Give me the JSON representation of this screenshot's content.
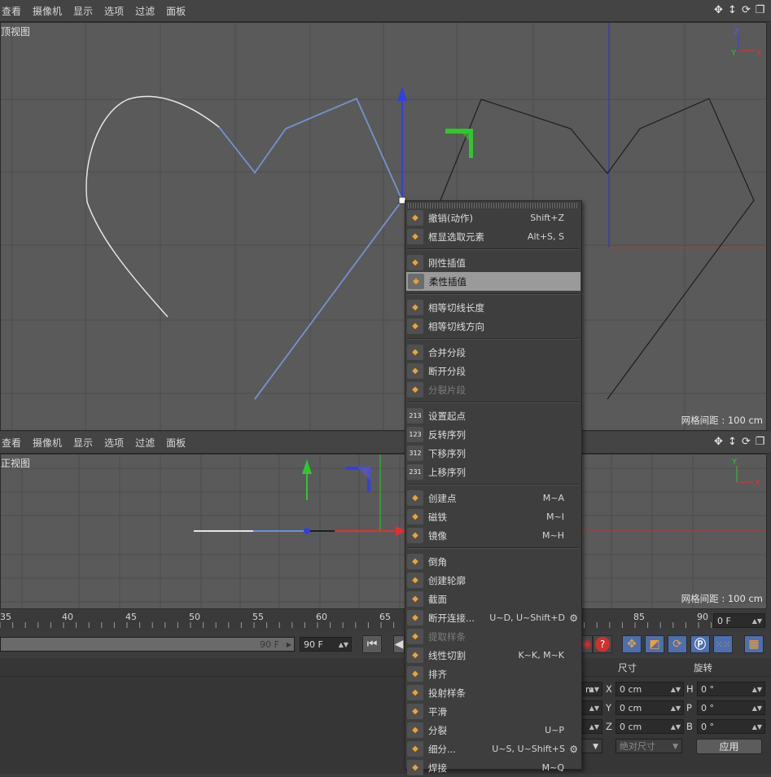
{
  "top_view": {
    "menu": [
      "查看",
      "摄像机",
      "显示",
      "选项",
      "过滤",
      "面板"
    ],
    "label": "顶视图",
    "grid_spacing": "网格间距 : 100 cm",
    "axis": {
      "z": "Z",
      "y": "Y",
      "x": "X"
    }
  },
  "front_view": {
    "menu": [
      "查看",
      "摄像机",
      "显示",
      "选项",
      "过滤",
      "面板"
    ],
    "label": "正视图",
    "grid_spacing": "网格间距 : 100 cm",
    "axis": {
      "y": "Y",
      "x": "X"
    }
  },
  "nav_icons": [
    "move-view-icon",
    "zoom-view-icon",
    "rotate-view-icon",
    "toggle-view-icon"
  ],
  "context_menu": {
    "groups": [
      [
        {
          "label": "撤销(动作)",
          "shortcut": "Shift+Z",
          "icon": "undo-icon"
        },
        {
          "label": "框显选取元素",
          "shortcut": "Alt+S, S",
          "icon": "frame-selected-icon"
        }
      ],
      [
        {
          "label": "刚性插值",
          "shortcut": "",
          "icon": "hard-interpolation-icon"
        },
        {
          "label": "柔性插值",
          "shortcut": "",
          "icon": "soft-interpolation-icon",
          "highlighted": true
        }
      ],
      [
        {
          "label": "相等切线长度",
          "shortcut": "",
          "icon": "equal-tangent-length-icon"
        },
        {
          "label": "相等切线方向",
          "shortcut": "",
          "icon": "equal-tangent-direction-icon"
        }
      ],
      [
        {
          "label": "合并分段",
          "shortcut": "",
          "icon": "join-segment-icon"
        },
        {
          "label": "断开分段",
          "shortcut": "",
          "icon": "break-segment-icon"
        },
        {
          "label": "分裂片段",
          "shortcut": "",
          "icon": "explode-segments-icon",
          "disabled": true
        }
      ],
      [
        {
          "label": "设置起点",
          "shortcut": "",
          "icon": "set-first-point-icon",
          "glyph": "213"
        },
        {
          "label": "反转序列",
          "shortcut": "",
          "icon": "reverse-sequence-icon",
          "glyph": "123"
        },
        {
          "label": "下移序列",
          "shortcut": "",
          "icon": "move-down-sequence-icon",
          "glyph": "312"
        },
        {
          "label": "上移序列",
          "shortcut": "",
          "icon": "move-up-sequence-icon",
          "glyph": "231"
        }
      ],
      [
        {
          "label": "创建点",
          "shortcut": "M~A",
          "icon": "create-point-icon"
        },
        {
          "label": "磁铁",
          "shortcut": "M~I",
          "icon": "magnet-icon"
        },
        {
          "label": "镜像",
          "shortcut": "M~H",
          "icon": "mirror-icon"
        }
      ],
      [
        {
          "label": "倒角",
          "shortcut": "",
          "icon": "chamfer-icon"
        },
        {
          "label": "创建轮廓",
          "shortcut": "",
          "icon": "create-outline-icon"
        },
        {
          "label": "截面",
          "shortcut": "",
          "icon": "cross-section-icon"
        },
        {
          "label": "断开连接...",
          "shortcut": "U~D, U~Shift+D",
          "icon": "disconnect-icon",
          "gear": true
        },
        {
          "label": "提取样条",
          "shortcut": "",
          "icon": "edge-to-spline-icon",
          "disabled": true
        },
        {
          "label": "线性切割",
          "shortcut": "K~K, M~K",
          "icon": "line-cut-icon"
        },
        {
          "label": "排齐",
          "shortcut": "",
          "icon": "line-up-icon"
        },
        {
          "label": "投射样条",
          "shortcut": "",
          "icon": "project-spline-icon"
        },
        {
          "label": "平滑",
          "shortcut": "",
          "icon": "smooth-icon"
        },
        {
          "label": "分裂",
          "shortcut": "U~P",
          "icon": "split-icon"
        },
        {
          "label": "细分...",
          "shortcut": "U~S, U~Shift+S",
          "icon": "subdivide-icon",
          "gear": true
        },
        {
          "label": "焊接",
          "shortcut": "M~Q",
          "icon": "weld-icon"
        }
      ]
    ]
  },
  "timeline": {
    "ticks": [
      "35",
      "40",
      "45",
      "50",
      "55",
      "60",
      "65",
      "85",
      "90"
    ],
    "current_frame": "0 F",
    "end_frame_slider": "90 F",
    "end_frame_field": "90 F"
  },
  "attributes": {
    "size_header": "尺寸",
    "rotation_header": "旋转",
    "size_x": "0 cm",
    "size_y": "0 cm",
    "size_z": "0 cm",
    "rot_h": "0 °",
    "rot_p": "0 °",
    "rot_b": "0 °",
    "pos_partial": "m",
    "size_mode": "绝对尺寸",
    "apply_label": "应用",
    "labels": {
      "x": "X",
      "y": "Y",
      "z": "Z",
      "h": "H",
      "p": "P",
      "b": "B"
    }
  },
  "colors": {
    "viewport_bg": "#5a5a5a",
    "selected_spline": "#6b8fd6",
    "axis_red": "#e23030",
    "axis_green": "#2ec82e",
    "axis_blue": "#3340e0",
    "menu_highlight": "#9a9a9a"
  }
}
